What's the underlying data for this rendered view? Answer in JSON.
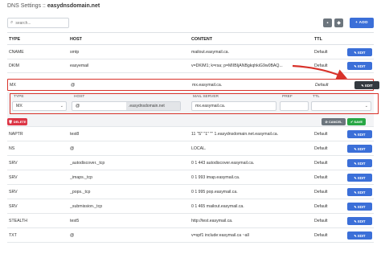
{
  "header": {
    "title_prefix": "DNS Settings ::",
    "domain": "easydnsdomain.net"
  },
  "toolbar": {
    "search_placeholder": "search...",
    "add_label": "+ ADD"
  },
  "table": {
    "columns": [
      "TYPE",
      "HOST",
      "CONTENT",
      "TTL"
    ],
    "edit_label": "✎ EDIT",
    "rows_top": [
      {
        "type": "CNAME",
        "host": "smtp",
        "content": "mailout.easymail.ca.",
        "ttl": "Default"
      },
      {
        "type": "DKIM",
        "host": "easyemail",
        "content": "v=DKIM1; k=rsa; p=MIIBIjANBgkqhkiG9w0BAQ...",
        "ttl": "Default"
      }
    ],
    "mx_row": {
      "type": "MX",
      "host": "@",
      "content": "mx.easymail.ca.",
      "ttl": "Default"
    },
    "rows_bottom": [
      {
        "type": "NAPTR",
        "host": "test8",
        "content": "11 \"S\" \"1\" \"\" 1.easydnsdomain.net.easymail.ca.",
        "ttl": "Default"
      },
      {
        "type": "NS",
        "host": "@",
        "content": "LOCAL.",
        "ttl": "Default"
      },
      {
        "type": "SRV",
        "host": "_autodiscover._tcp",
        "content": "0 1 443 autodiscover.easymail.ca.",
        "ttl": "Default"
      },
      {
        "type": "SRV",
        "host": "_imaps._tcp",
        "content": "0 1 993 imap.easymail.ca.",
        "ttl": "Default"
      },
      {
        "type": "SRV",
        "host": "_pops._tcp",
        "content": "0 1 995 pop.easymail.ca.",
        "ttl": "Default"
      },
      {
        "type": "SRV",
        "host": "_submission._tcp",
        "content": "0 1 465 mailout.easymail.ca.",
        "ttl": "Default"
      },
      {
        "type": "STEALTH",
        "host": "test5",
        "content": "http://test.easymail.ca.",
        "ttl": "Default"
      },
      {
        "type": "TXT",
        "host": "@",
        "content": "v=spf1 include:easymail.ca ~all",
        "ttl": "Default"
      }
    ]
  },
  "editor": {
    "labels": {
      "type": "TYPE",
      "host": "HOST",
      "mail_server": "MAIL SERVER",
      "pref": "PREF",
      "ttl": "TTL"
    },
    "type_value": "MX",
    "host_value": "@",
    "host_suffix": ".easydnsdomain.net",
    "mail_server_value": "mx.easymail.ca.",
    "pref_value": "",
    "ttl_value": "",
    "delete_label": "🗑 DELETE",
    "cancel_label": "⊘ CANCEL",
    "save_label": "✔ SAVE"
  },
  "colors": {
    "primary": "#3b6fd8",
    "danger": "#dc3545",
    "success": "#28a745",
    "secondary": "#6c757d",
    "highlight": "#d8322a"
  }
}
